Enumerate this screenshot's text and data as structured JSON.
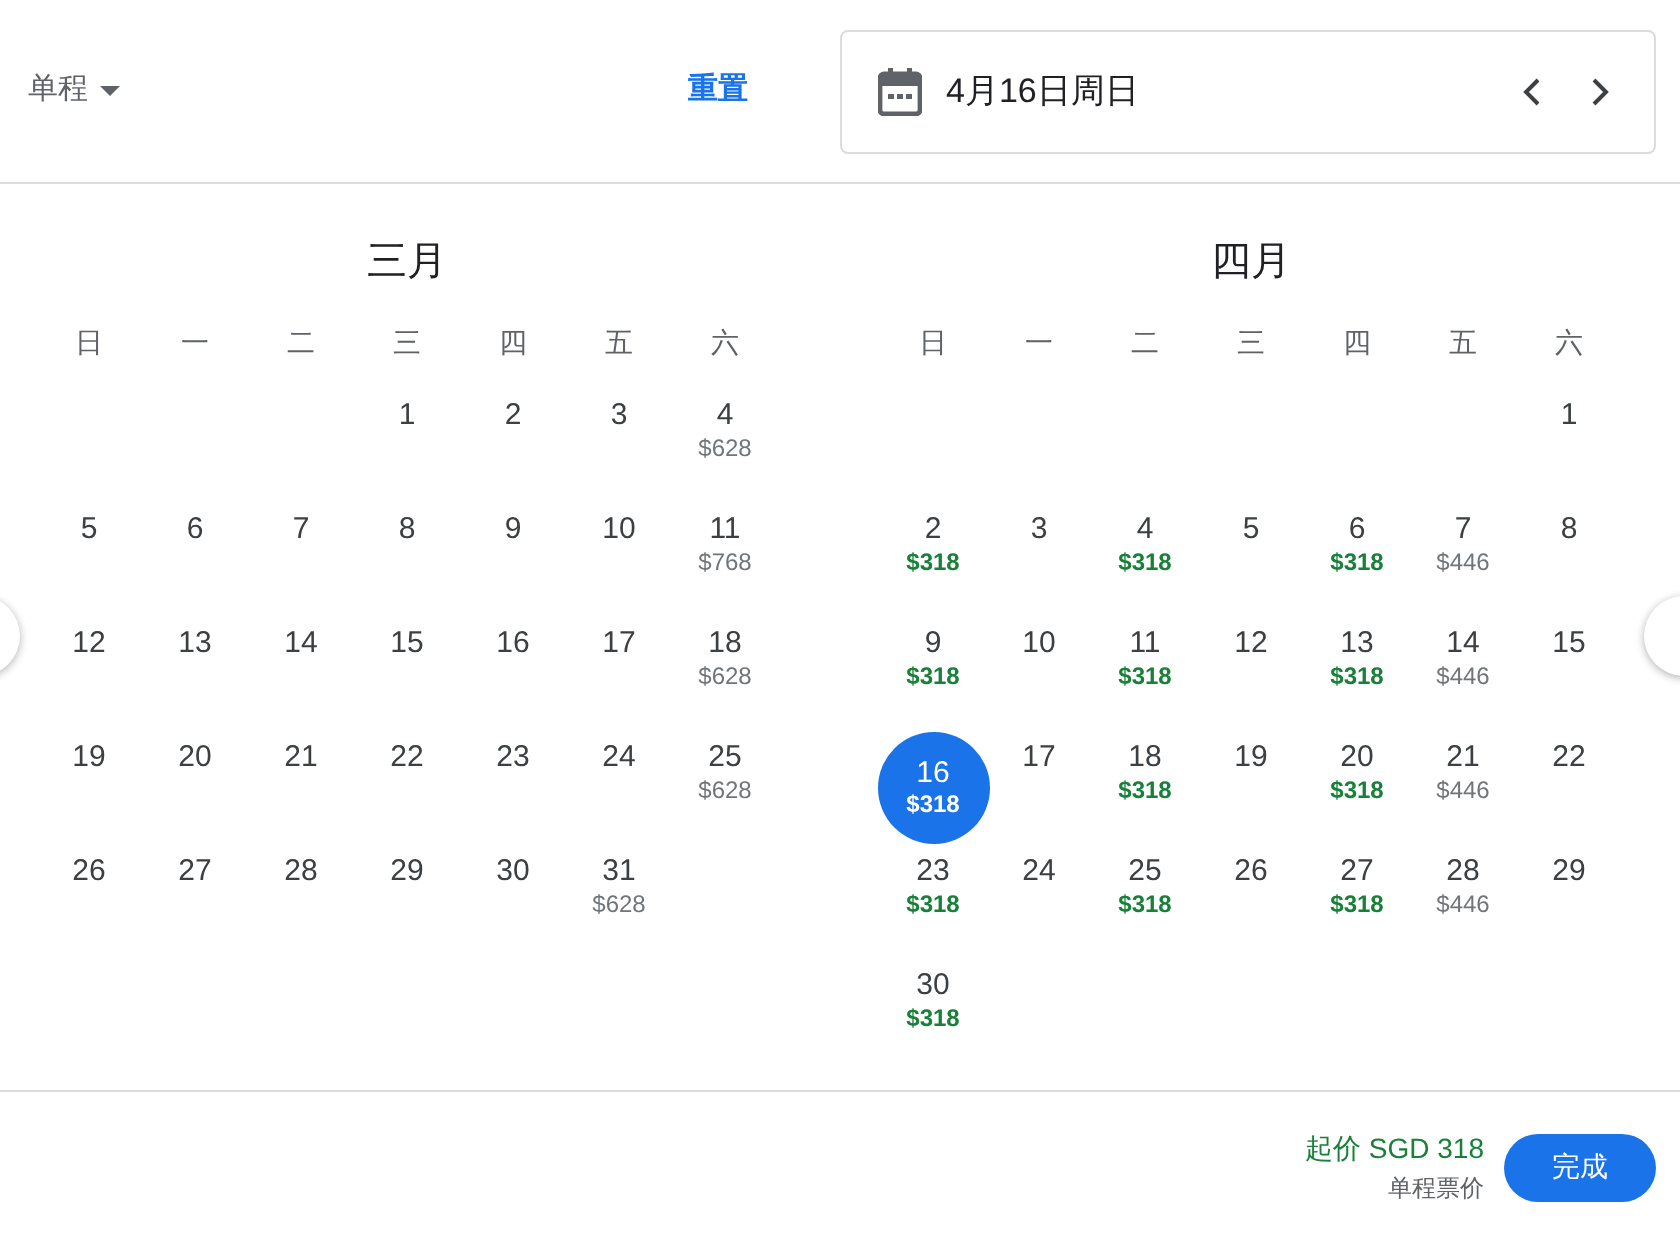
{
  "trip_type": {
    "label": "单程"
  },
  "reset": "重置",
  "date_field": {
    "value": "4月16日周日"
  },
  "months": [
    {
      "title": "三月",
      "weekdays": [
        "日",
        "一",
        "二",
        "三",
        "四",
        "五",
        "六"
      ],
      "weeks": [
        {
          "kind": "first",
          "days": [
            {
              "day": "1",
              "selected": false
            },
            {
              "day": "2",
              "selected": false
            },
            {
              "day": "3",
              "selected": false
            },
            {
              "day": "4",
              "price": "$628",
              "cheap": false,
              "selected": false
            }
          ]
        },
        {
          "kind": "full",
          "days": [
            {
              "day": "5",
              "selected": false
            },
            {
              "day": "6",
              "selected": false
            },
            {
              "day": "7",
              "selected": false
            },
            {
              "day": "8",
              "selected": false
            },
            {
              "day": "9",
              "selected": false
            },
            {
              "day": "10",
              "selected": false
            },
            {
              "day": "11",
              "price": "$768",
              "cheap": false,
              "selected": false
            }
          ]
        },
        {
          "kind": "full",
          "days": [
            {
              "day": "12",
              "selected": false
            },
            {
              "day": "13",
              "selected": false
            },
            {
              "day": "14",
              "selected": false
            },
            {
              "day": "15",
              "selected": false
            },
            {
              "day": "16",
              "selected": false
            },
            {
              "day": "17",
              "selected": false
            },
            {
              "day": "18",
              "price": "$628",
              "cheap": false,
              "selected": false
            }
          ]
        },
        {
          "kind": "full",
          "days": [
            {
              "day": "19",
              "selected": false
            },
            {
              "day": "20",
              "selected": false
            },
            {
              "day": "21",
              "selected": false
            },
            {
              "day": "22",
              "selected": false
            },
            {
              "day": "23",
              "selected": false
            },
            {
              "day": "24",
              "selected": false
            },
            {
              "day": "25",
              "price": "$628",
              "cheap": false,
              "selected": false
            }
          ]
        },
        {
          "kind": "last",
          "days": [
            {
              "day": "26",
              "selected": false
            },
            {
              "day": "27",
              "selected": false
            },
            {
              "day": "28",
              "selected": false
            },
            {
              "day": "29",
              "selected": false
            },
            {
              "day": "30",
              "selected": false
            },
            {
              "day": "31",
              "price": "$628",
              "cheap": false,
              "selected": false
            }
          ]
        }
      ]
    },
    {
      "title": "四月",
      "weekdays": [
        "日",
        "一",
        "二",
        "三",
        "四",
        "五",
        "六"
      ],
      "weeks": [
        {
          "kind": "first",
          "days": [
            {
              "day": "1",
              "selected": false
            }
          ]
        },
        {
          "kind": "full",
          "days": [
            {
              "day": "2",
              "price": "$318",
              "cheap": true,
              "selected": false
            },
            {
              "day": "3",
              "selected": false
            },
            {
              "day": "4",
              "price": "$318",
              "cheap": true,
              "selected": false
            },
            {
              "day": "5",
              "selected": false
            },
            {
              "day": "6",
              "price": "$318",
              "cheap": true,
              "selected": false
            },
            {
              "day": "7",
              "price": "$446",
              "cheap": false,
              "selected": false
            },
            {
              "day": "8",
              "selected": false
            }
          ]
        },
        {
          "kind": "full",
          "days": [
            {
              "day": "9",
              "price": "$318",
              "cheap": true,
              "selected": false
            },
            {
              "day": "10",
              "selected": false
            },
            {
              "day": "11",
              "price": "$318",
              "cheap": true,
              "selected": false
            },
            {
              "day": "12",
              "selected": false
            },
            {
              "day": "13",
              "price": "$318",
              "cheap": true,
              "selected": false
            },
            {
              "day": "14",
              "price": "$446",
              "cheap": false,
              "selected": false
            },
            {
              "day": "15",
              "selected": false
            }
          ]
        },
        {
          "kind": "full",
          "days": [
            {
              "day": "16",
              "price": "$318",
              "selected": true
            },
            {
              "day": "17",
              "selected": false
            },
            {
              "day": "18",
              "price": "$318",
              "cheap": true,
              "selected": false
            },
            {
              "day": "19",
              "selected": false
            },
            {
              "day": "20",
              "price": "$318",
              "cheap": true,
              "selected": false
            },
            {
              "day": "21",
              "price": "$446",
              "cheap": false,
              "selected": false
            },
            {
              "day": "22",
              "selected": false
            }
          ]
        },
        {
          "kind": "full",
          "days": [
            {
              "day": "23",
              "price": "$318",
              "cheap": true,
              "selected": false
            },
            {
              "day": "24",
              "selected": false
            },
            {
              "day": "25",
              "price": "$318",
              "cheap": true,
              "selected": false
            },
            {
              "day": "26",
              "selected": false
            },
            {
              "day": "27",
              "price": "$318",
              "cheap": true,
              "selected": false
            },
            {
              "day": "28",
              "price": "$446",
              "cheap": false,
              "selected": false
            },
            {
              "day": "29",
              "selected": false
            }
          ]
        },
        {
          "kind": "last",
          "days": [
            {
              "day": "30",
              "price": "$318",
              "cheap": true,
              "selected": false
            }
          ]
        }
      ]
    }
  ],
  "footer": {
    "price": "起价 SGD 318",
    "note": "单程票价",
    "done": "完成"
  }
}
